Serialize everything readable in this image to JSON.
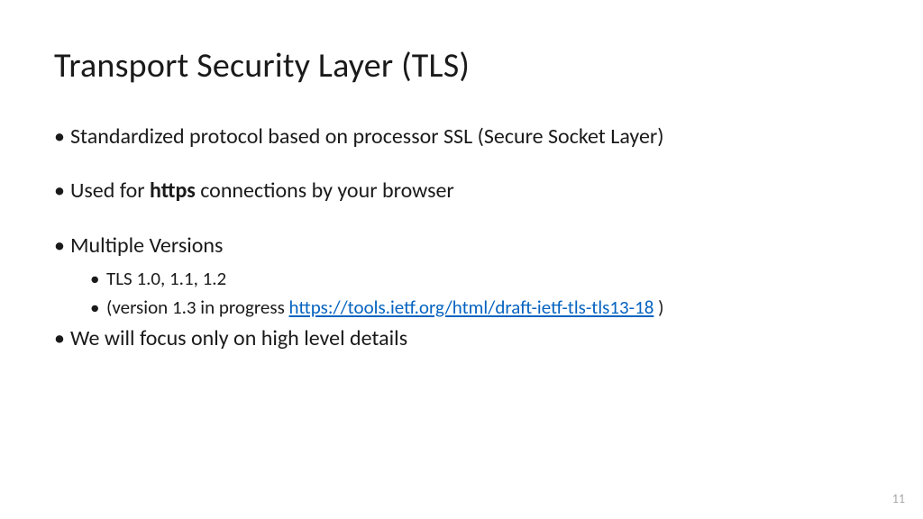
{
  "title": "Transport Security Layer (TLS)",
  "bullets": {
    "b1": "Standardized protocol based on processor SSL (Secure Socket Layer)",
    "b2_pre": "Used for ",
    "b2_bold": "https",
    "b2_post": " connections by your browser",
    "b3": "Multiple Versions",
    "b3_sub1": "TLS 1.0, 1.1, 1.2",
    "b3_sub2_pre": "(version 1.3 in progress ",
    "b3_sub2_link": "https://tools.ietf.org/html/draft-ietf-tls-tls13-18",
    "b3_sub2_post": "  )",
    "b4": "We will focus only on high level details"
  },
  "page_number": "11"
}
